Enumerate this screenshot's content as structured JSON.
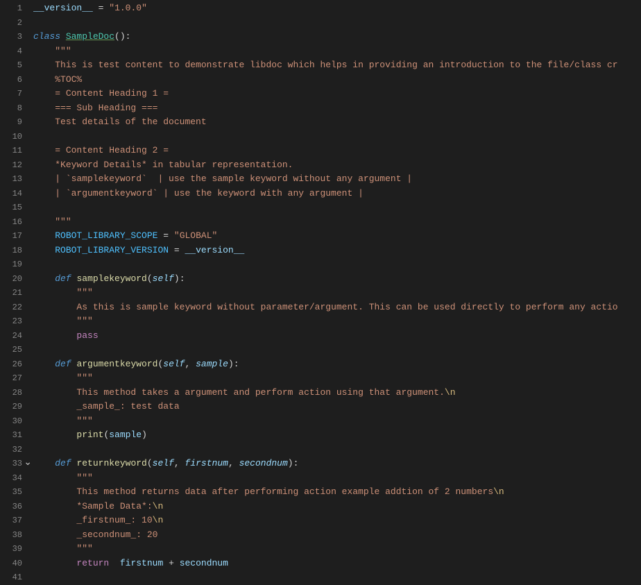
{
  "code": {
    "lines": [
      {
        "n": 1,
        "html": "<span class='var'>__version__</span> <span class='op'>=</span> <span class='str'>\"1.0.0\"</span>"
      },
      {
        "n": 2,
        "html": ""
      },
      {
        "n": 3,
        "html": "<span class='kw' style='color:#569cd6;font-style:italic'>class</span> <span class='cls-u'>SampleDoc</span><span class='punc'>():</span>"
      },
      {
        "n": 4,
        "html": "    <span class='str'>\"\"\"</span>"
      },
      {
        "n": 5,
        "html": "    <span class='str'>This is test content to demonstrate libdoc which helps in providing an introduction to the file/class cr</span>"
      },
      {
        "n": 6,
        "html": "    <span class='str'>%TOC%</span>"
      },
      {
        "n": 7,
        "html": "    <span class='str'>= Content Heading 1 =</span>"
      },
      {
        "n": 8,
        "html": "    <span class='str'>=== Sub Heading ===</span>"
      },
      {
        "n": 9,
        "html": "    <span class='str'>Test details of the document</span>"
      },
      {
        "n": 10,
        "html": ""
      },
      {
        "n": 11,
        "html": "    <span class='str'>= Content Heading 2 =</span>"
      },
      {
        "n": 12,
        "html": "    <span class='str'>*Keyword Details* in tabular representation.</span>"
      },
      {
        "n": 13,
        "html": "    <span class='str'>| `samplekeyword`  | use the sample keyword without any argument |</span>"
      },
      {
        "n": 14,
        "html": "    <span class='str'>| `argumentkeyword` | use the keyword with any argument |</span>"
      },
      {
        "n": 15,
        "html": ""
      },
      {
        "n": 16,
        "html": "    <span class='str'>\"\"\"</span>"
      },
      {
        "n": 17,
        "html": "    <span class='const'>ROBOT_LIBRARY_SCOPE</span> <span class='op'>=</span> <span class='str'>\"GLOBAL\"</span>"
      },
      {
        "n": 18,
        "html": "    <span class='const'>ROBOT_LIBRARY_VERSION</span> <span class='op'>=</span> <span class='var'>__version__</span>"
      },
      {
        "n": 19,
        "html": ""
      },
      {
        "n": 20,
        "html": "    <span class='kw' style='font-style:italic'>def</span> <span class='fn'>samplekeyword</span><span class='punc'>(</span><span class='kw-it' style='color:#9cdcfe;font-style:italic'>self</span><span class='punc'>):</span>"
      },
      {
        "n": 21,
        "html": "        <span class='str'>\"\"\"</span>"
      },
      {
        "n": 22,
        "html": "        <span class='str'>As this is sample keyword without parameter/argument. This can be used directly to perform any actio</span>"
      },
      {
        "n": 23,
        "html": "        <span class='str'>\"\"\"</span>"
      },
      {
        "n": 24,
        "html": "        <span class='flow'>pass</span>"
      },
      {
        "n": 25,
        "html": ""
      },
      {
        "n": 26,
        "html": "    <span class='kw' style='font-style:italic'>def</span> <span class='fn'>argumentkeyword</span><span class='punc'>(</span><span class='kw-it' style='color:#9cdcfe;font-style:italic'>self</span><span class='punc'>,</span> <span class='kw-it' style='color:#9cdcfe;font-style:italic'>sample</span><span class='punc'>):</span>"
      },
      {
        "n": 27,
        "html": "        <span class='str'>\"\"\"</span>"
      },
      {
        "n": 28,
        "html": "        <span class='str'>This method takes a argument and perform action using that argument.</span><span class='esc'>\\n</span>"
      },
      {
        "n": 29,
        "html": "        <span class='str'>_sample_: test data</span>"
      },
      {
        "n": 30,
        "html": "        <span class='str'>\"\"\"</span>"
      },
      {
        "n": 31,
        "html": "        <span class='fn'>print</span><span class='punc'>(</span><span class='var'>sample</span><span class='punc'>)</span>"
      },
      {
        "n": 32,
        "html": ""
      },
      {
        "n": 33,
        "fold": true,
        "html": "    <span class='kw' style='font-style:italic'>def</span> <span class='fn'>returnkeyword</span><span class='punc'>(</span><span class='kw-it' style='color:#9cdcfe;font-style:italic'>self</span><span class='punc'>,</span> <span class='kw-it' style='color:#9cdcfe;font-style:italic'>firstnum</span><span class='punc'>,</span> <span class='kw-it' style='color:#9cdcfe;font-style:italic'>secondnum</span><span class='punc'>):</span>"
      },
      {
        "n": 34,
        "html": "        <span class='str'>\"\"\"</span>"
      },
      {
        "n": 35,
        "html": "        <span class='str'>This method returns data after performing action example addtion of 2 numbers</span><span class='esc'>\\n</span>"
      },
      {
        "n": 36,
        "html": "        <span class='str'>*Sample Data*:</span><span class='esc'>\\n</span>"
      },
      {
        "n": 37,
        "html": "        <span class='str'>_firstnum_: 10</span><span class='esc'>\\n</span>"
      },
      {
        "n": 38,
        "html": "        <span class='str'>_secondnum_: 20</span>"
      },
      {
        "n": 39,
        "html": "        <span class='str'>\"\"\"</span>"
      },
      {
        "n": 40,
        "html": "        <span class='flow'>return</span>  <span class='var'>firstnum</span> <span class='op'>+</span> <span class='var'>secondnum</span>"
      },
      {
        "n": 41,
        "html": ""
      }
    ]
  }
}
